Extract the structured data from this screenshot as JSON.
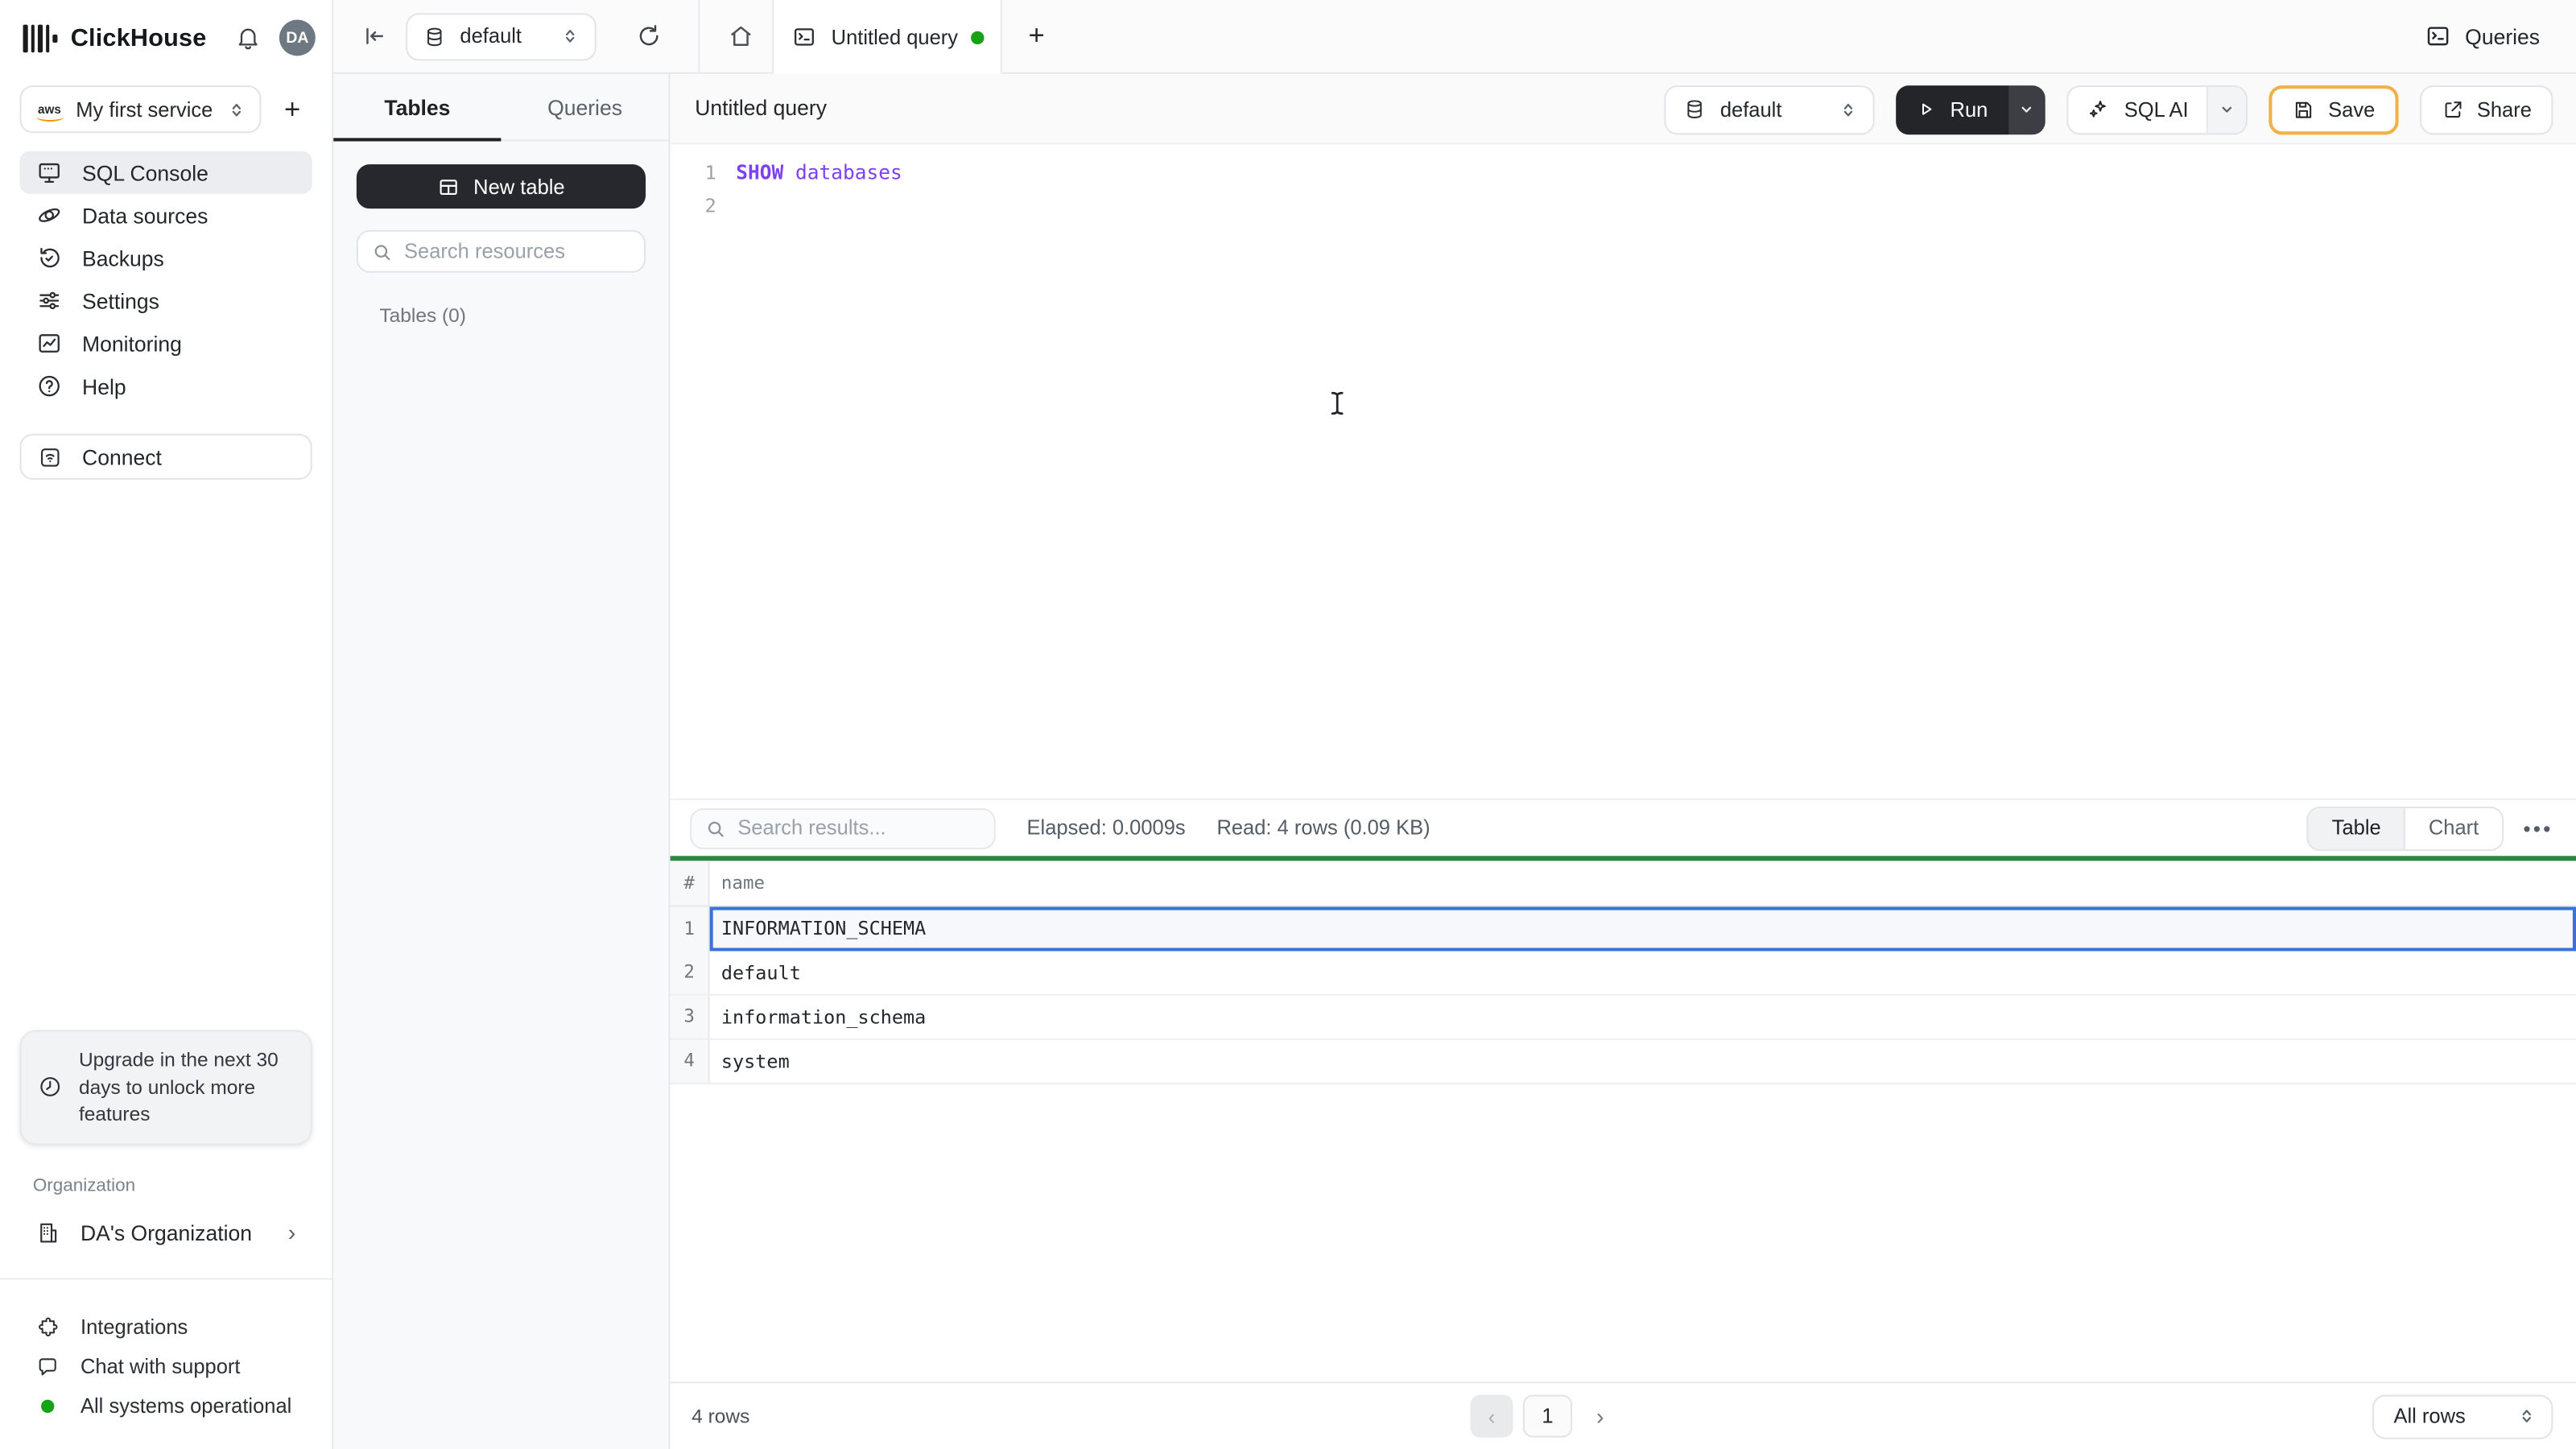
{
  "brand": {
    "name": "ClickHouse",
    "avatar": "DA"
  },
  "sidebar": {
    "service": "My first service",
    "aws": "aws",
    "nav": [
      {
        "label": "SQL Console"
      },
      {
        "label": "Data sources"
      },
      {
        "label": "Backups"
      },
      {
        "label": "Settings"
      },
      {
        "label": "Monitoring"
      },
      {
        "label": "Help"
      }
    ],
    "connect": "Connect",
    "upgrade": "Upgrade in the next 30 days to unlock more features",
    "org_section": "Organization",
    "org_name": "DA's Organization",
    "org_chevron": "›",
    "integrations": "Integrations",
    "chat": "Chat with support",
    "status": "All systems operational"
  },
  "topbar": {
    "database": "default",
    "tab_title": "Untitled query",
    "add_tab": "+",
    "queries": "Queries"
  },
  "explorer": {
    "tab_tables": "Tables",
    "tab_queries": "Queries",
    "new_table": "New table",
    "search_placeholder": "Search resources",
    "section": "Tables (0)"
  },
  "query": {
    "title": "Untitled query",
    "database": "default",
    "run": "Run",
    "sql_ai": "SQL AI",
    "save": "Save",
    "share": "Share",
    "lines": [
      {
        "n": "1",
        "kw": "SHOW",
        "rest": " databases"
      },
      {
        "n": "2",
        "kw": "",
        "rest": ""
      }
    ]
  },
  "results": {
    "search_placeholder": "Search results...",
    "elapsed": "Elapsed: 0.0009s",
    "read": "Read: 4 rows (0.09 KB)",
    "toggle_table": "Table",
    "toggle_chart": "Chart",
    "more": "•••",
    "col_hash": "#",
    "col_name": "name",
    "rows": [
      {
        "n": "1",
        "name": "INFORMATION_SCHEMA"
      },
      {
        "n": "2",
        "name": "default"
      },
      {
        "n": "3",
        "name": "information_schema"
      },
      {
        "n": "4",
        "name": "system"
      }
    ],
    "row_count": "4 rows",
    "prev": "‹",
    "page": "1",
    "next": "›",
    "page_size": "All rows"
  },
  "colors": {
    "accent_green_dot": "#15A215",
    "table_top_green": "#2E8540",
    "selected_row_blue": "#3A72DC",
    "save_border_amber": "#F0B04A",
    "sql_purple": "#7D41F0"
  }
}
